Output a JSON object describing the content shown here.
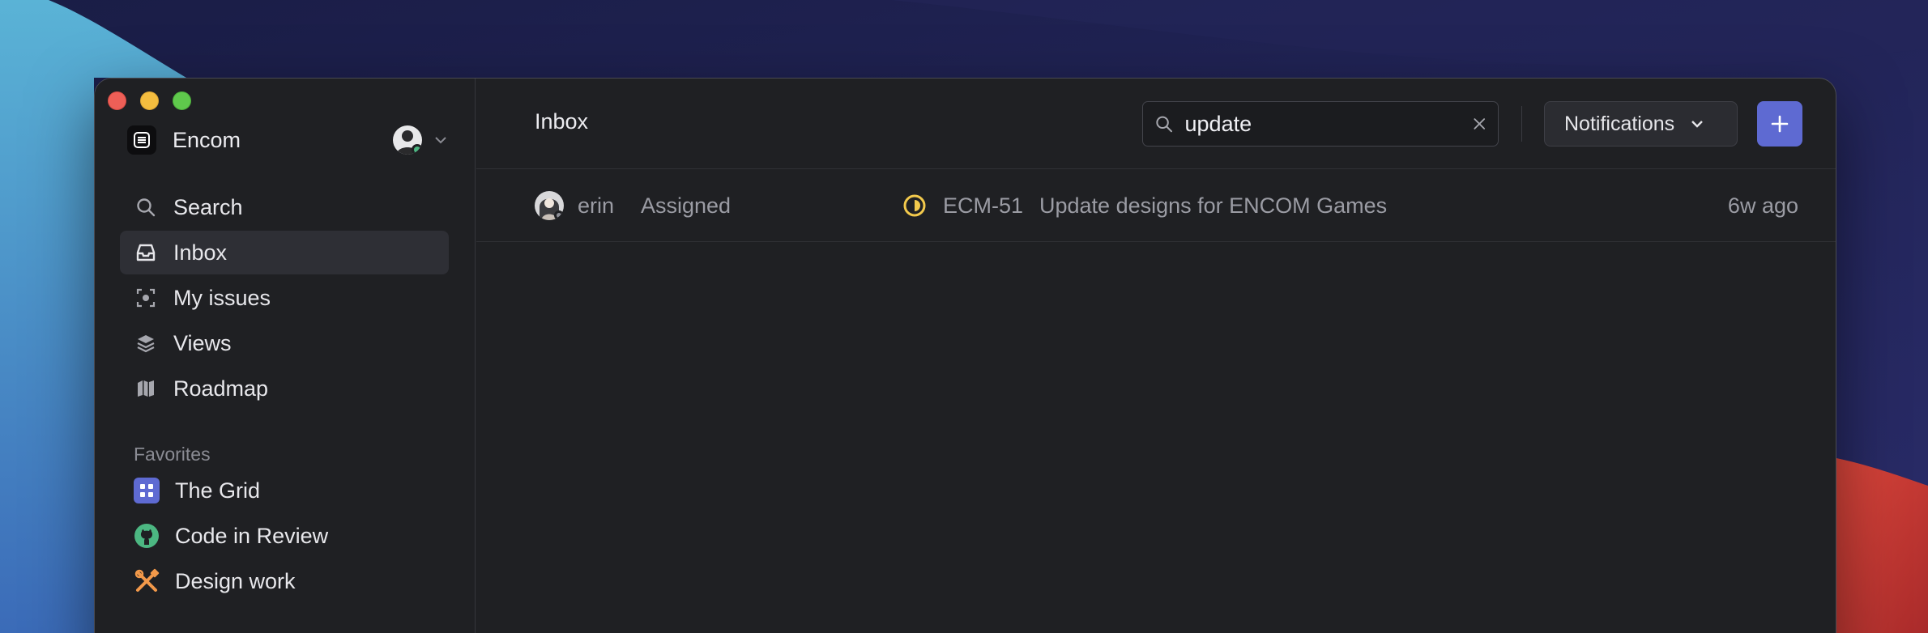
{
  "workspace": {
    "name": "Encom"
  },
  "nav": [
    {
      "label": "Search",
      "icon": "search-icon"
    },
    {
      "label": "Inbox",
      "icon": "inbox-icon",
      "active": true
    },
    {
      "label": "My issues",
      "icon": "target-icon"
    },
    {
      "label": "Views",
      "icon": "layers-icon"
    },
    {
      "label": "Roadmap",
      "icon": "map-icon"
    }
  ],
  "favorites": {
    "title": "Favorites",
    "items": [
      {
        "label": "The Grid",
        "icon": "grid-icon",
        "color": "#5e6ad2"
      },
      {
        "label": "Code in Review",
        "icon": "github-icon",
        "color": "#4cb782"
      },
      {
        "label": "Design work",
        "icon": "tools-icon",
        "color": "#f2994a"
      }
    ]
  },
  "header": {
    "title": "Inbox",
    "search_value": "update",
    "notifications_label": "Notifications",
    "add_label": "+"
  },
  "inbox": [
    {
      "user": "erin",
      "action": "Assigned",
      "status_color": "#f2c94c",
      "issue_id": "ECM-51",
      "title": "Update designs for ENCOM Games",
      "time": "6w ago"
    }
  ],
  "colors": {
    "accent": "#5e6ad2",
    "window_bg": "#1f2023",
    "online": "#4cb782"
  }
}
